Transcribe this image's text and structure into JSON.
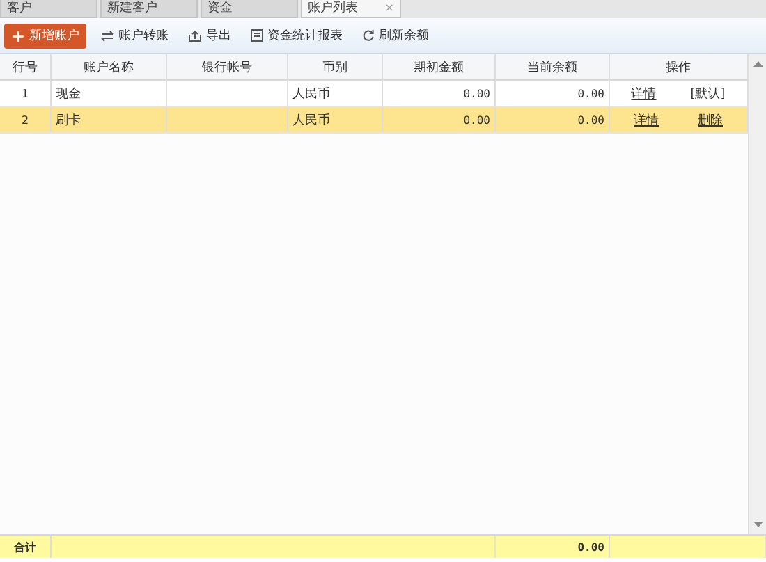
{
  "tabs": [
    {
      "label": "客户",
      "selected": false
    },
    {
      "label": "新建客户",
      "selected": false
    },
    {
      "label": "资金",
      "selected": false
    },
    {
      "label": "账户列表",
      "selected": true,
      "close": "×"
    }
  ],
  "toolbar": [
    {
      "kind": "primary",
      "label": "新增账户",
      "icon": "+"
    },
    {
      "kind": "transfer",
      "label": "账户转账"
    },
    {
      "kind": "export",
      "label": "导出"
    },
    {
      "kind": "report",
      "label": "资金统计报表"
    },
    {
      "kind": "refresh",
      "label": "刷新余额"
    }
  ],
  "table": {
    "columns": [
      "行号",
      "账户名称",
      "银行帐号",
      "币别",
      "期初金额",
      "当前余额",
      "操作"
    ],
    "rows": [
      {
        "selected": false,
        "cells": [
          "1",
          "现金",
          "",
          "人民币",
          "0.00",
          "0.00"
        ],
        "actions": [
          {
            "kind": "link",
            "label": "详情"
          },
          {
            "kind": "text",
            "label": "[默认]"
          }
        ]
      },
      {
        "selected": true,
        "cells": [
          "2",
          "刷卡",
          "",
          "人民币",
          "0.00",
          "0.00"
        ],
        "actions": [
          {
            "kind": "link",
            "label": "详情"
          },
          {
            "kind": "link",
            "label": "删除"
          }
        ]
      }
    ],
    "total": {
      "label": "合计",
      "value": "0.00"
    }
  }
}
